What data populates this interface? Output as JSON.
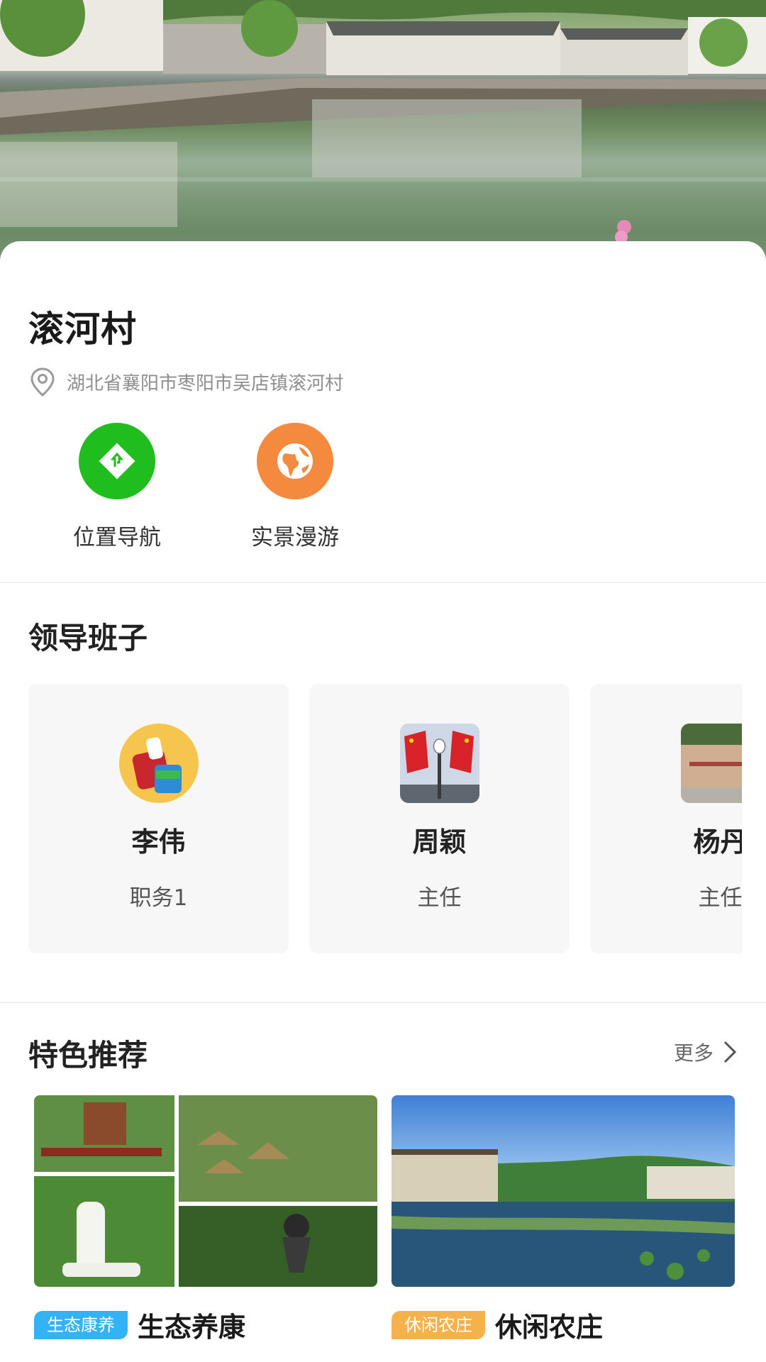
{
  "village": {
    "name": "滚河村",
    "address": "湖北省襄阳市枣阳市吴店镇滚河村"
  },
  "quick_actions": [
    {
      "label": "位置导航",
      "icon": "navigation-arrow-icon",
      "color": "#1fbd1d"
    },
    {
      "label": "实景漫游",
      "icon": "globe-icon",
      "color": "#f48a3e"
    }
  ],
  "leadership": {
    "title": "领导班子",
    "members": [
      {
        "name": "李伟",
        "role": "职务1"
      },
      {
        "name": "周颖",
        "role": "主任"
      },
      {
        "name": "杨丹",
        "role": "主任"
      }
    ]
  },
  "featured": {
    "title": "特色推荐",
    "more_label": "更多",
    "items": [
      {
        "tag": "生态康养",
        "title": "生态养康",
        "tag_color": "#33b3f5"
      },
      {
        "tag": "休闲农庄",
        "title": "休闲农庄",
        "tag_color": "#f5b24a"
      }
    ]
  }
}
